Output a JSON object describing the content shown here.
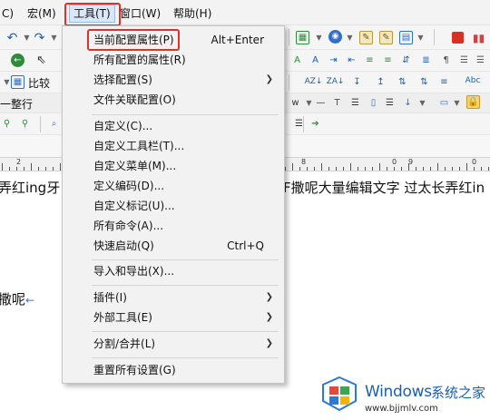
{
  "menubar": {
    "items": [
      "C)",
      "宏(M)",
      "工具(T)",
      "窗口(W)",
      "帮助(H)"
    ]
  },
  "toolbar": {
    "compare_label": "比较",
    "wrap_label": "一整行",
    "abc_label": "Abc"
  },
  "editor": {
    "line1_left": "弄红ing牙",
    "line1_right": "F撒呢大量编辑文字 过太长弄红in",
    "line2": "撒呢",
    "line_end_mark": "←"
  },
  "ruler": {
    "labels": [
      "2",
      "0",
      "8",
      "0",
      "9",
      "0"
    ]
  },
  "tools_menu": {
    "items": [
      {
        "label": "当前配置属性(P)",
        "shortcut": "Alt+Enter",
        "submenu": false,
        "highlighted": true
      },
      {
        "label": "所有配置的属性(R)",
        "shortcut": "",
        "submenu": false
      },
      {
        "label": "选择配置(S)",
        "shortcut": "",
        "submenu": true
      },
      {
        "label": "文件关联配置(O)",
        "shortcut": "",
        "submenu": false
      },
      {
        "label": "自定义(C)...",
        "shortcut": "",
        "submenu": false
      },
      {
        "label": "自定义工具栏(T)...",
        "shortcut": "",
        "submenu": false
      },
      {
        "label": "自定义菜单(M)...",
        "shortcut": "",
        "submenu": false
      },
      {
        "label": "定义编码(D)...",
        "shortcut": "",
        "submenu": false
      },
      {
        "label": "自定义标记(U)...",
        "shortcut": "",
        "submenu": false
      },
      {
        "label": "所有命令(A)...",
        "shortcut": "",
        "submenu": false
      },
      {
        "label": "快速启动(Q)",
        "shortcut": "Ctrl+Q",
        "submenu": false
      },
      {
        "label": "导入和导出(X)...",
        "shortcut": "",
        "submenu": false
      },
      {
        "label": "插件(I)",
        "shortcut": "",
        "submenu": true
      },
      {
        "label": "外部工具(E)",
        "shortcut": "",
        "submenu": true
      },
      {
        "label": "分割/合并(L)",
        "shortcut": "",
        "submenu": true
      },
      {
        "label": "重置所有设置(G)",
        "shortcut": "",
        "submenu": false
      }
    ]
  },
  "watermark": {
    "title": "Windows",
    "subtitle": "系统之家",
    "url": "www.bjjmlv.com"
  },
  "colors": {
    "highlight_box": "#e0302a",
    "menu_bg": "#f2f2f2",
    "watermark_blue": "#1a5fb4"
  }
}
